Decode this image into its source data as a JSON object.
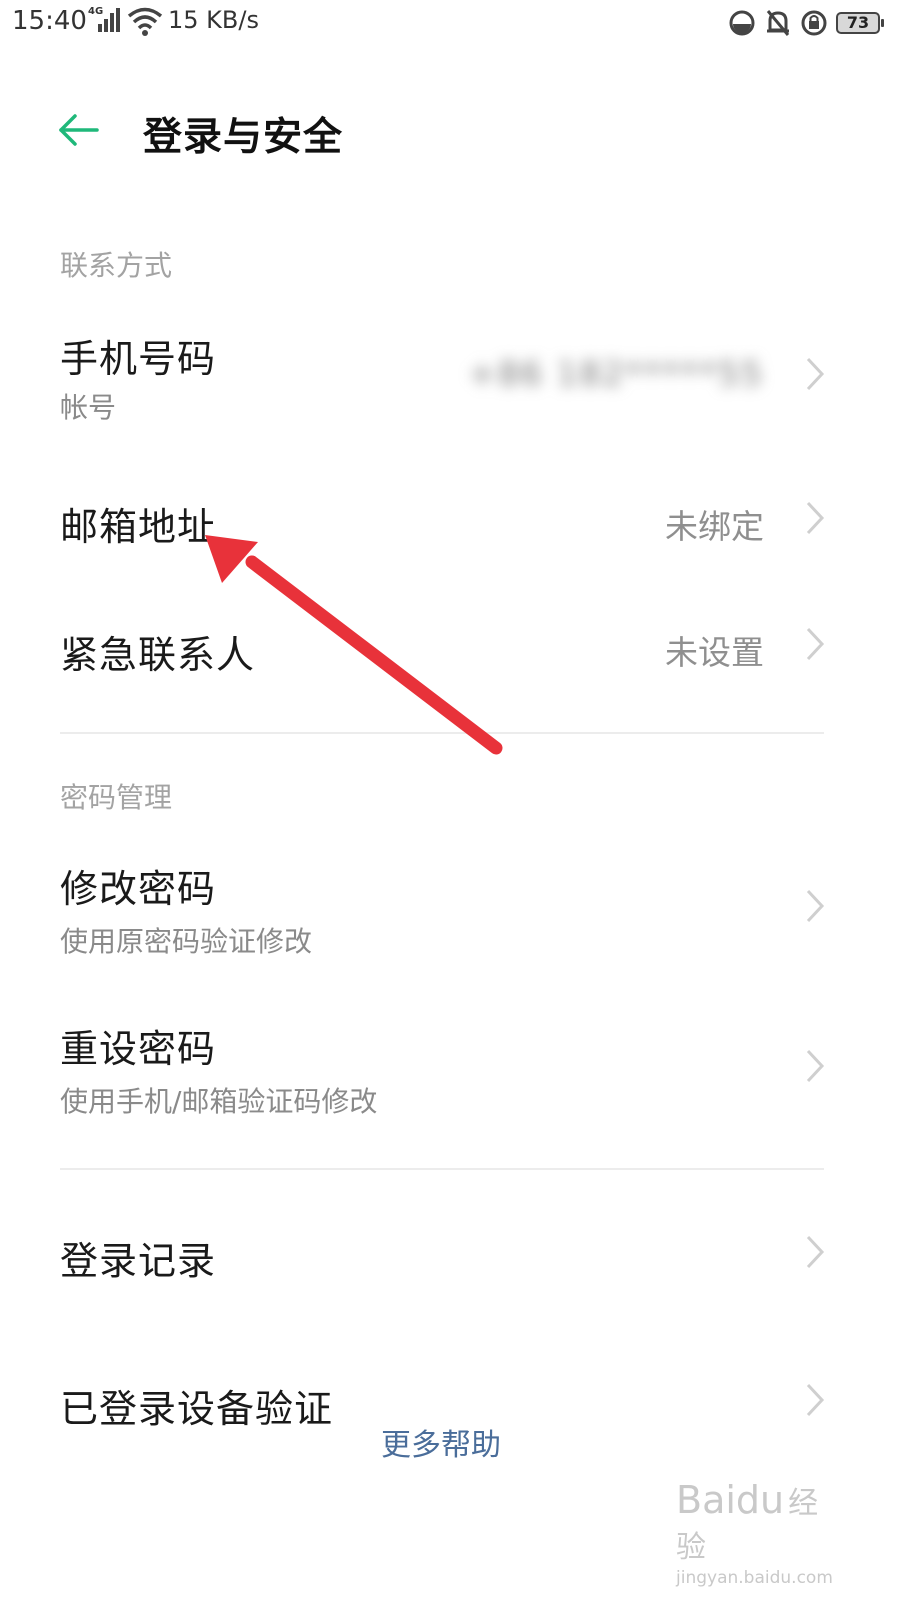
{
  "status_bar": {
    "time": "15:40",
    "network": "4G",
    "speed": "15 KB/s",
    "battery": "73",
    "icons": [
      "signal-icon",
      "wifi-icon",
      "data-saver-icon",
      "bell-off-icon",
      "rotation-lock-icon",
      "battery-icon"
    ]
  },
  "header": {
    "title": "登录与安全",
    "back_icon": "back-arrow-icon",
    "accent_color": "#1fb87a"
  },
  "sections": {
    "contact": {
      "label": "联系方式",
      "items": [
        {
          "title": "手机号码",
          "subtitle": "帐号",
          "value": "+86 182*****55"
        },
        {
          "title": "邮箱地址",
          "value": "未绑定"
        },
        {
          "title": "紧急联系人",
          "value": "未设置"
        }
      ]
    },
    "password": {
      "label": "密码管理",
      "items": [
        {
          "title": "修改密码",
          "subtitle": "使用原密码验证修改"
        },
        {
          "title": "重设密码",
          "subtitle": "使用手机/邮箱验证码修改"
        }
      ]
    },
    "other": {
      "items": [
        {
          "title": "登录记录"
        },
        {
          "title": "已登录设备验证"
        }
      ]
    }
  },
  "footer": {
    "more_help": "更多帮助"
  },
  "watermark": {
    "logo": "Baidu",
    "logo_cn": "经验",
    "url": "jingyan.baidu.com"
  },
  "annotation": {
    "arrow_color": "#e8323a"
  }
}
